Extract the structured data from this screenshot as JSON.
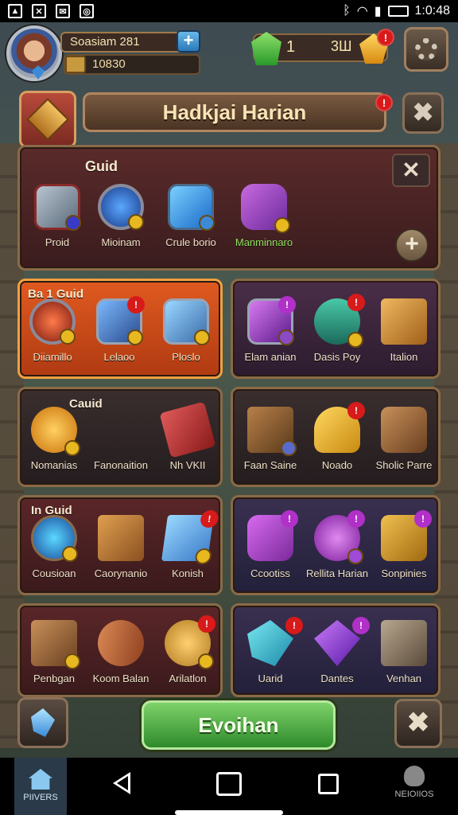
{
  "status_bar": {
    "time": "1:0:48"
  },
  "player": {
    "name": "Soasiam 281",
    "coins": "10830"
  },
  "currency": {
    "gems": "1",
    "gold": "3Ш"
  },
  "title": {
    "label": "Hadkjai Harian"
  },
  "guild_panel": {
    "title": "Guid",
    "items": [
      {
        "label": "Proid"
      },
      {
        "label": "Mioinam"
      },
      {
        "label": "Crule borio"
      },
      {
        "label": "Manminnaro"
      }
    ]
  },
  "panels": [
    {
      "title": "Ba  1 Guid",
      "items": [
        "Diiamillo",
        "Lelaoo",
        "Ploslo"
      ]
    },
    {
      "title": "",
      "items": [
        "Elam anian",
        "Dasis Poy",
        "Italion"
      ]
    },
    {
      "title": "Cauid",
      "items": [
        "Nomanias",
        "Fanonaition",
        "Nh VKII"
      ]
    },
    {
      "title": "",
      "items": [
        "Faan Saine",
        "Noado",
        "Sholic Parre"
      ]
    },
    {
      "title": "In  Guid",
      "items": [
        "Cousioan",
        "Caorynanio",
        "Konish"
      ]
    },
    {
      "title": "",
      "items": [
        "Ccootiss",
        "Rellita Harian",
        "Sonpinies"
      ]
    },
    {
      "title": "",
      "items": [
        "Penbgan",
        "Koom Balan",
        "Arilatlon"
      ]
    },
    {
      "title": "",
      "items": [
        "Uarid",
        "Dantes",
        "Venhan"
      ]
    }
  ],
  "action_button": {
    "label": "Evoihan"
  },
  "nav": {
    "home_label": "PIIVERS",
    "profile_label": "NEIOIIOS"
  },
  "colors": {
    "accent_orange": "#e05a20",
    "action_green": "#4aa83a",
    "badge_red": "#d81a1a"
  }
}
